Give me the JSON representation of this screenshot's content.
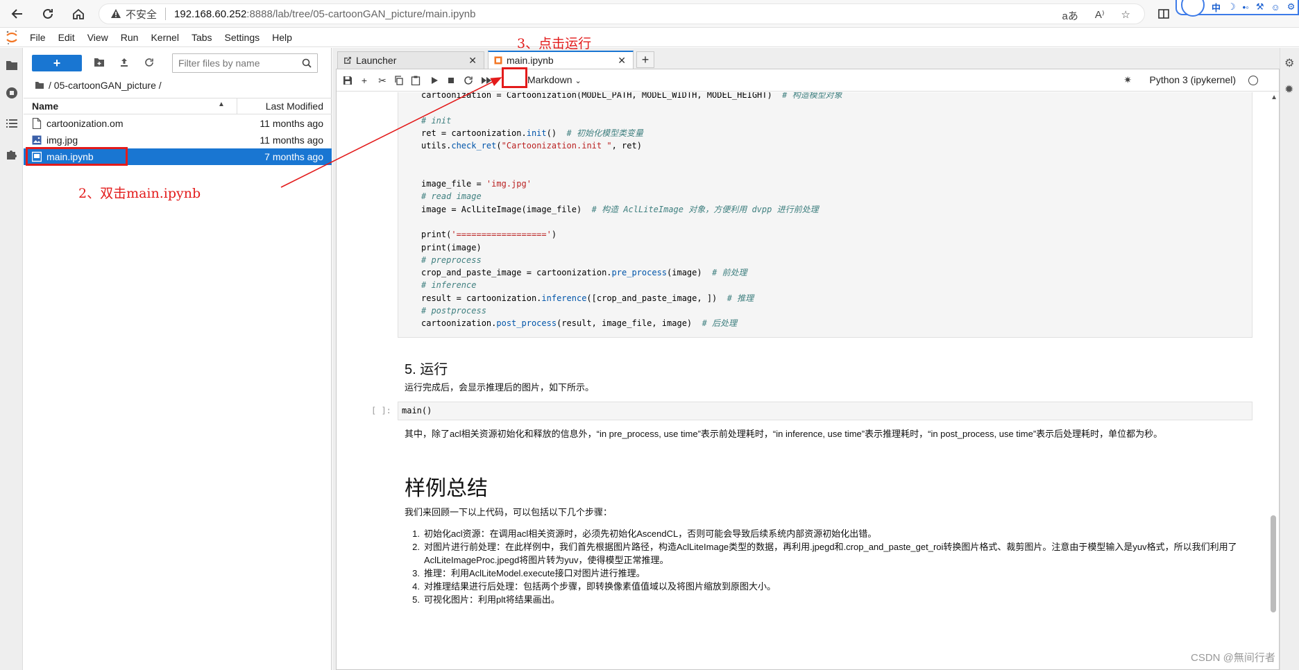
{
  "browser": {
    "insecure_label": "不安全",
    "url_host": "192.168.60.252",
    "url_path": ":8888/lab/tree/05-cartoonGAN_picture/main.ipynb",
    "ime": [
      "中",
      "☽",
      "•◦",
      "⚒",
      "☺",
      "⚙"
    ]
  },
  "menu": [
    "File",
    "Edit",
    "View",
    "Run",
    "Kernel",
    "Tabs",
    "Settings",
    "Help"
  ],
  "file_browser": {
    "new_label": "+",
    "filter_placeholder": "Filter files by name",
    "breadcrumb": "/ 05-cartoonGAN_picture /",
    "col_name": "Name",
    "col_modified": "Last Modified",
    "files": [
      {
        "name": "cartoonization.om",
        "modified": "11 months ago",
        "type": "file"
      },
      {
        "name": "img.jpg",
        "modified": "11 months ago",
        "type": "image"
      },
      {
        "name": "main.ipynb",
        "modified": "7 months ago",
        "type": "notebook",
        "selected": true
      }
    ]
  },
  "annotations": {
    "step2": "2、双击main.ipynb",
    "step3": "3、点击运行"
  },
  "tabs": [
    {
      "label": "Launcher",
      "active": false
    },
    {
      "label": "main.ipynb",
      "active": true
    }
  ],
  "notebook": {
    "cell_type": "Markdown",
    "kernel": "Python 3 (ipykernel)",
    "code_lines": [
      [
        {
          "t": "cartoonization = Cartoonization(MODEL_PATH, MODEL_WIDTH, MODEL_HEIGHT)  "
        },
        {
          "t": "# 构造模型对象",
          "c": "cm"
        }
      ],
      [
        {
          "t": ""
        }
      ],
      [
        {
          "t": "# init",
          "c": "cm"
        }
      ],
      [
        {
          "t": "ret = cartoonization."
        },
        {
          "t": "init",
          "c": "fn"
        },
        {
          "t": "()  "
        },
        {
          "t": "# 初始化模型类变量",
          "c": "cm"
        }
      ],
      [
        {
          "t": "utils."
        },
        {
          "t": "check_ret",
          "c": "fn"
        },
        {
          "t": "("
        },
        {
          "t": "\"Cartoonization.init \"",
          "c": "str"
        },
        {
          "t": ", ret)"
        }
      ],
      [
        {
          "t": ""
        }
      ],
      [
        {
          "t": ""
        }
      ],
      [
        {
          "t": "image_file = "
        },
        {
          "t": "'img.jpg'",
          "c": "str"
        }
      ],
      [
        {
          "t": "# read image",
          "c": "cm"
        }
      ],
      [
        {
          "t": "image = AclLiteImage(image_file)  "
        },
        {
          "t": "# 构造 AclLiteImage 对象，方便利用 dvpp 进行前处理",
          "c": "cm"
        }
      ],
      [
        {
          "t": ""
        }
      ],
      [
        {
          "t": "print("
        },
        {
          "t": "'=================='",
          "c": "str"
        },
        {
          "t": ")"
        }
      ],
      [
        {
          "t": "print(image)"
        }
      ],
      [
        {
          "t": "# preprocess",
          "c": "cm"
        }
      ],
      [
        {
          "t": "crop_and_paste_image = cartoonization."
        },
        {
          "t": "pre_process",
          "c": "fn"
        },
        {
          "t": "(image)  "
        },
        {
          "t": "# 前处理",
          "c": "cm"
        }
      ],
      [
        {
          "t": "# inference",
          "c": "cm"
        }
      ],
      [
        {
          "t": "result = cartoonization."
        },
        {
          "t": "inference",
          "c": "fn"
        },
        {
          "t": "([crop_and_paste_image, ])  "
        },
        {
          "t": "# 推理",
          "c": "cm"
        }
      ],
      [
        {
          "t": "# postprocess",
          "c": "cm"
        }
      ],
      [
        {
          "t": "cartoonization."
        },
        {
          "t": "post_process",
          "c": "fn"
        },
        {
          "t": "(result, image_file, image)  "
        },
        {
          "t": "# 后处理",
          "c": "cm"
        }
      ]
    ],
    "section_run": "5. 运行",
    "run_desc": "运行完成后，会显示推理后的图片，如下所示。",
    "prompt": "[ ]:",
    "main_call": "main()",
    "timing_desc": "其中，除了acl相关资源初始化和释放的信息外，“in pre_process, use time”表示前处理耗时，“in inference, use time”表示推理耗时，“in post_process, use time”表示后处理耗时，单位都为秒。",
    "summary_title": "样例总结",
    "summary_intro": "我们来回顾一下以上代码，可以包括以下几个步骤：",
    "steps": [
      {
        "n": "1.",
        "text": "初始化acl资源：在调用acl相关资源时，必须先初始化AscendCL，否则可能会导致后续系统内部资源初始化出错。"
      },
      {
        "n": "2.",
        "text": "对图片进行前处理：在此样例中，我们首先根据图片路径，构造AclLiteImage类型的数据，再利用.jpegd和.crop_and_paste_get_roi转换图片格式、裁剪图片。注意由于模型输入是yuv格式，所以我们利用了AclLiteImageProc.jpegd将图片转为yuv，使得模型正常推理。"
      },
      {
        "n": "3.",
        "text": "推理：利用AclLiteModel.execute接口对图片进行推理。"
      },
      {
        "n": "4.",
        "text": "对推理结果进行后处理：包括两个步骤，即转换像素值值域以及将图片缩放到原图大小。"
      },
      {
        "n": "5.",
        "text": "可视化图片：利用plt将结果画出。"
      }
    ]
  },
  "watermark": "CSDN @無间行者",
  "colors": {
    "accent": "#1976d2",
    "annotation": "#e31b1b"
  }
}
